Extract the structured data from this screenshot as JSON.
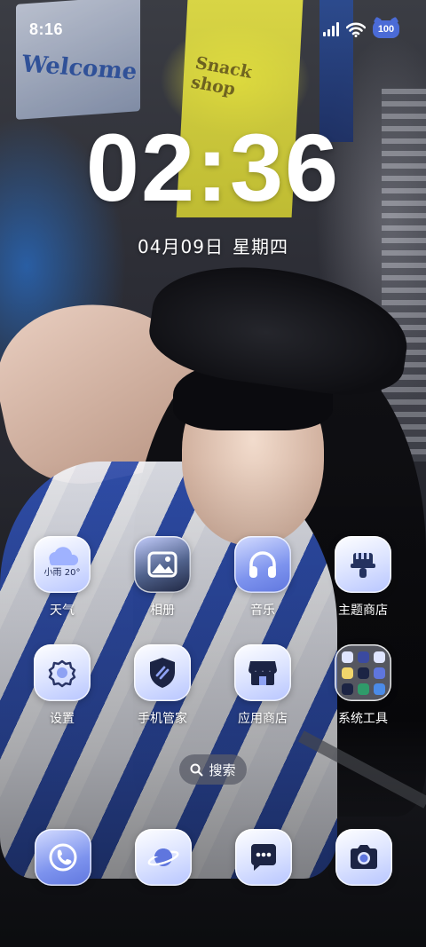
{
  "status_bar": {
    "time": "8:16",
    "battery": "100",
    "icons": [
      "signal-icon",
      "wifi-icon",
      "battery-icon"
    ]
  },
  "clock": {
    "time": "02:36",
    "date": "04月09日",
    "weekday": "星期四"
  },
  "apps": [
    {
      "label": "天气",
      "icon": "weather-icon",
      "widget_text": "小雨 20°"
    },
    {
      "label": "相册",
      "icon": "gallery-icon"
    },
    {
      "label": "音乐",
      "icon": "headphones-icon"
    },
    {
      "label": "主题商店",
      "icon": "brush-icon"
    },
    {
      "label": "设置",
      "icon": "gear-icon"
    },
    {
      "label": "手机管家",
      "icon": "shield-icon"
    },
    {
      "label": "应用商店",
      "icon": "store-icon"
    },
    {
      "label": "系统工具",
      "icon": "folder-icon"
    }
  ],
  "search": {
    "label": "搜索",
    "icon": "search-icon"
  },
  "dock": [
    {
      "icon": "phone-icon"
    },
    {
      "icon": "browser-planet-icon"
    },
    {
      "icon": "message-icon"
    },
    {
      "icon": "camera-icon"
    }
  ],
  "colors": {
    "accent_blue": "#5f76de",
    "battery_blue": "#4b6bd6"
  }
}
